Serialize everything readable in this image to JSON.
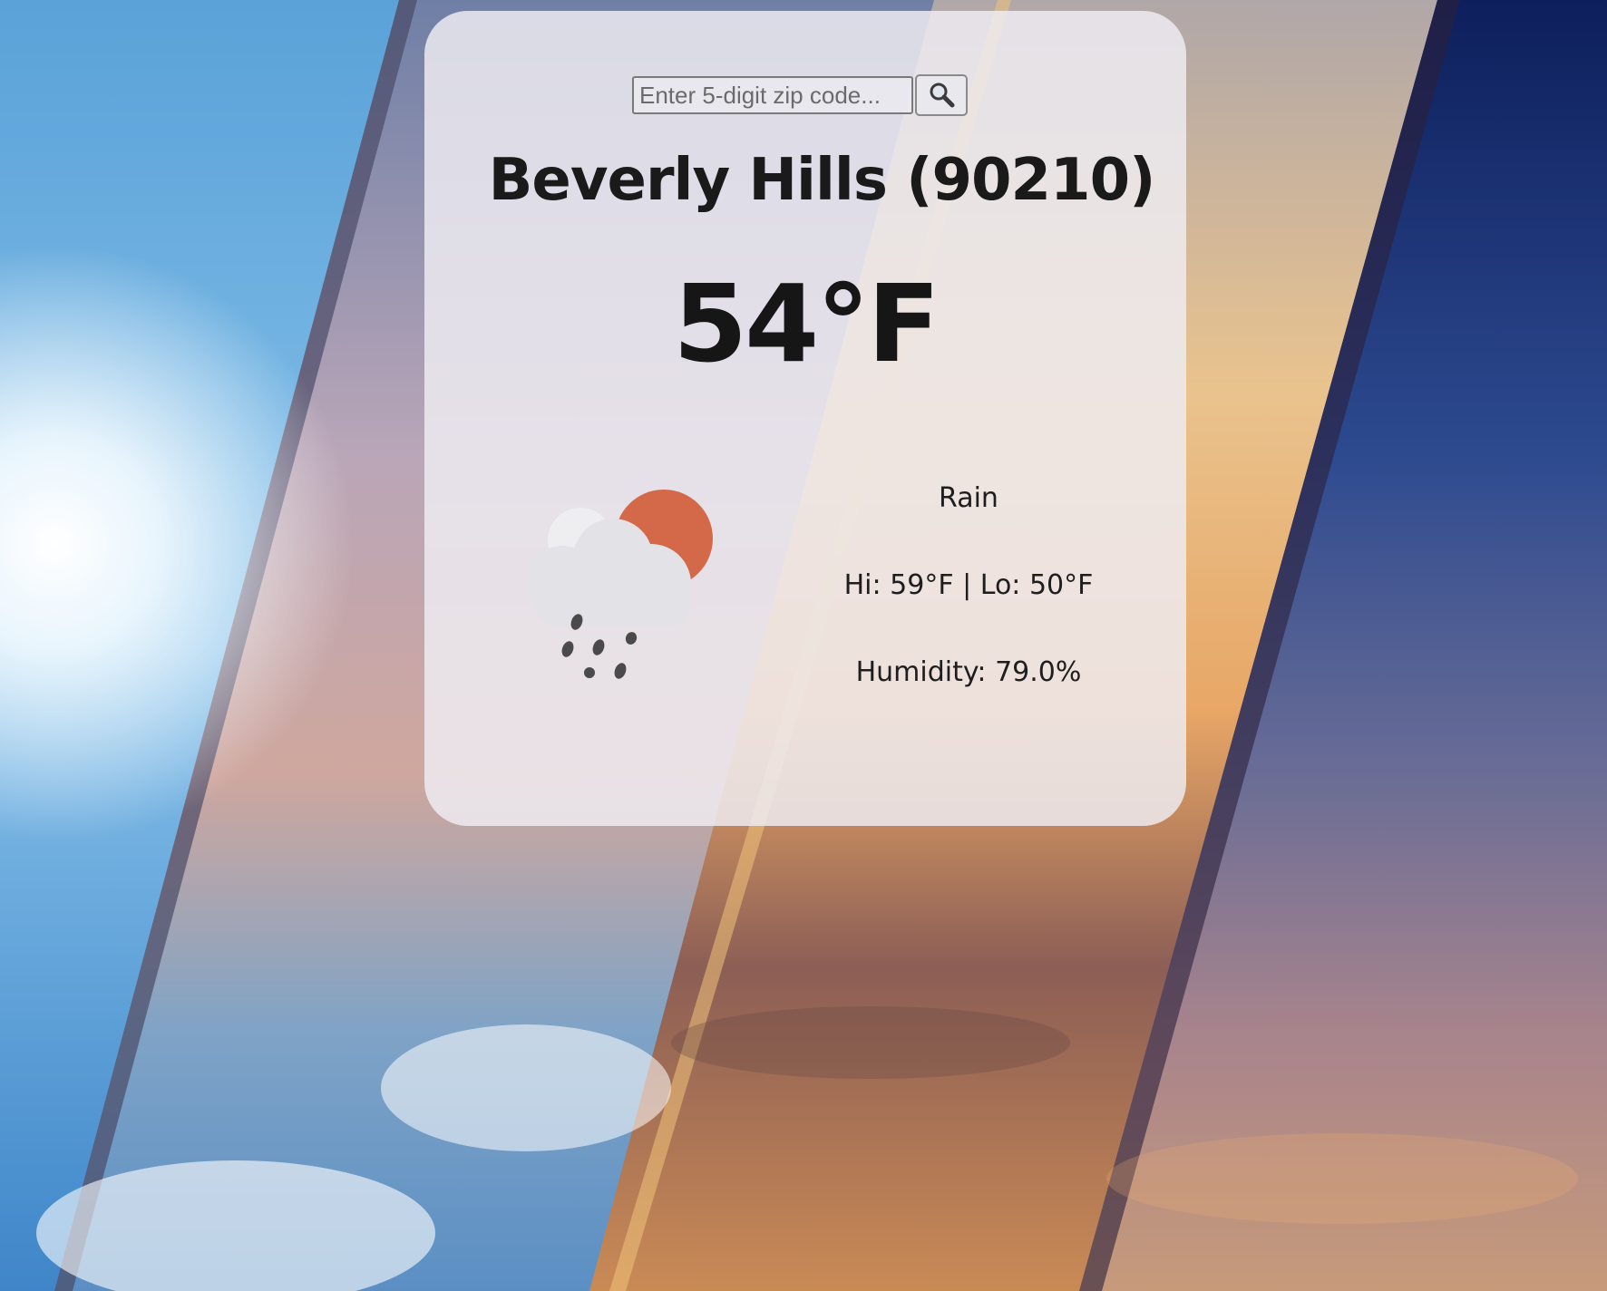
{
  "search": {
    "placeholder": "Enter 5-digit zip code...",
    "value": "",
    "button_icon": "search-icon"
  },
  "location": {
    "title": "Beverly Hills (90210)"
  },
  "current": {
    "temperature": "54°F",
    "icon": "sun-behind-rain-cloud-icon",
    "condition": "Rain",
    "hi_lo": "Hi: 59°F | Lo: 50°F",
    "humidity": "Humidity: 79.0%"
  },
  "colors": {
    "card_background": "#eeecf2",
    "sun": "#d4694a",
    "text": "#1a1a1a"
  }
}
